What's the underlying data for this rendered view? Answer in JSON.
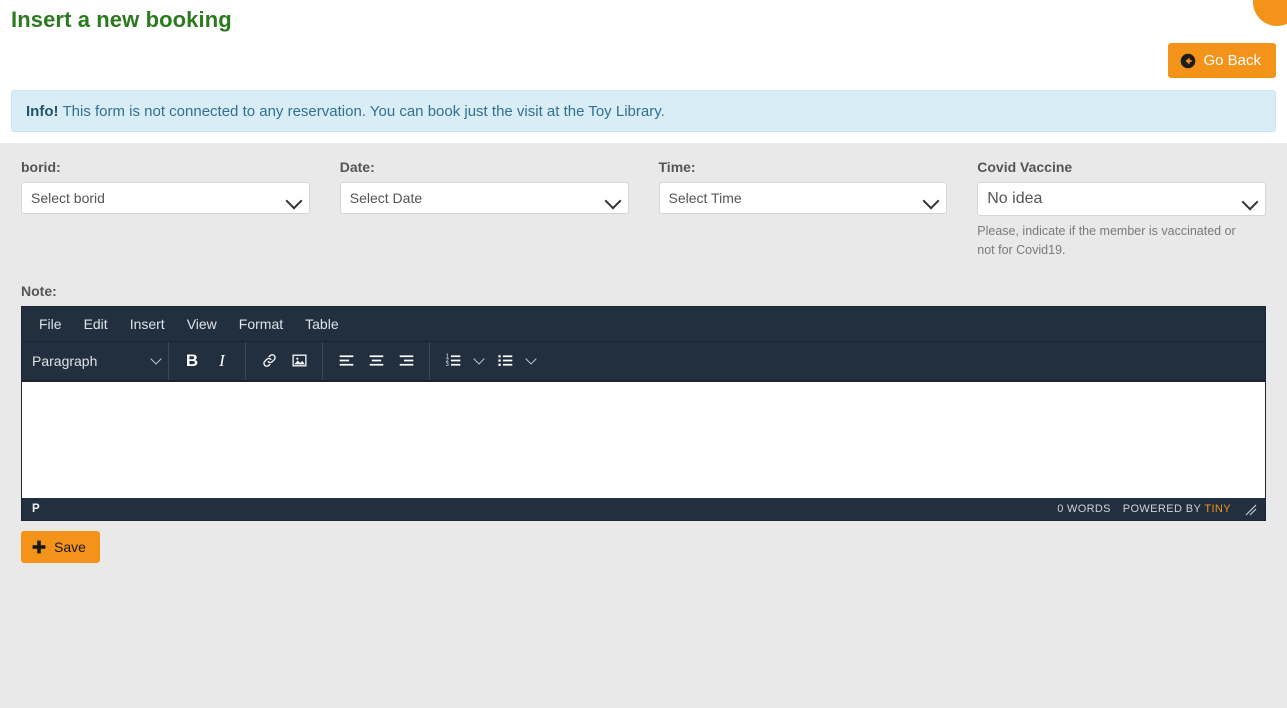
{
  "page": {
    "title": "Insert a new booking",
    "title_color": "#2c7a1f",
    "accent_color": "#f3931a"
  },
  "header": {
    "go_back_label": "Go Back",
    "go_back_icon": "arrow-circle-left-icon",
    "corner_fab_icon": "floating-action-button"
  },
  "alert": {
    "strong": "Info!",
    "text": "This form is not connected to any reservation. You can book just the visit at the Toy Library.",
    "background": "#d9edf7",
    "text_color": "#31708f"
  },
  "form": {
    "fields": [
      {
        "label": "borid:",
        "value": "Select borid",
        "name": "borid-select"
      },
      {
        "label": "Date:",
        "value": "Select Date",
        "name": "date-select"
      },
      {
        "label": "Time:",
        "value": "Select Time",
        "name": "time-select"
      },
      {
        "label": "Covid Vaccine",
        "value": "No idea",
        "name": "covid-vaccine-select",
        "help": "Please, indicate if the member is vaccinated or not for Covid19."
      }
    ],
    "note_label": "Note:",
    "save_label": "Save",
    "save_icon": "plus-icon"
  },
  "editor": {
    "menus": [
      "File",
      "Edit",
      "Insert",
      "View",
      "Format",
      "Table"
    ],
    "format_select": "Paragraph",
    "buttons": {
      "bold": "B",
      "italic": "I",
      "link": "link-icon",
      "image": "image-icon",
      "align_left": "align-left-icon",
      "align_center": "align-center-icon",
      "align_right": "align-right-icon",
      "numbered_list": "numbered-list-icon",
      "bullet_list": "bullet-list-icon"
    },
    "statusbar": {
      "path": "P",
      "words": "0 WORDS",
      "branding_prefix": "POWERED BY ",
      "branding_name": "TINY"
    },
    "body_text": ""
  }
}
